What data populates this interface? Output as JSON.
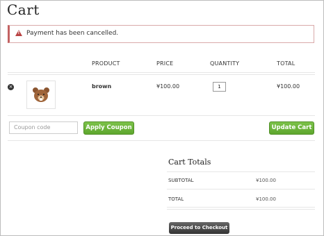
{
  "page": {
    "title": "Cart"
  },
  "notice": {
    "text": "Payment has been cancelled.",
    "icon": "warning-icon"
  },
  "table": {
    "headers": {
      "product": "PRODUCT",
      "price": "PRICE",
      "quantity": "QUANTITY",
      "total": "TOTAL"
    },
    "rows": [
      {
        "name": "brown",
        "price": "¥100.00",
        "quantity": "1",
        "total": "¥100.00"
      }
    ]
  },
  "coupon": {
    "placeholder": "Coupon code",
    "apply_label": "Apply Coupon"
  },
  "update_label": "Update Cart",
  "totals": {
    "title": "Cart Totals",
    "subtotal_label": "SUBTOTAL",
    "subtotal_value": "¥100.00",
    "total_label": "TOTAL",
    "total_value": "¥100.00"
  },
  "checkout_label": "Proceed to Checkout",
  "colors": {
    "green": "#5ea72e",
    "error": "#b94343",
    "dark": "#333333"
  }
}
